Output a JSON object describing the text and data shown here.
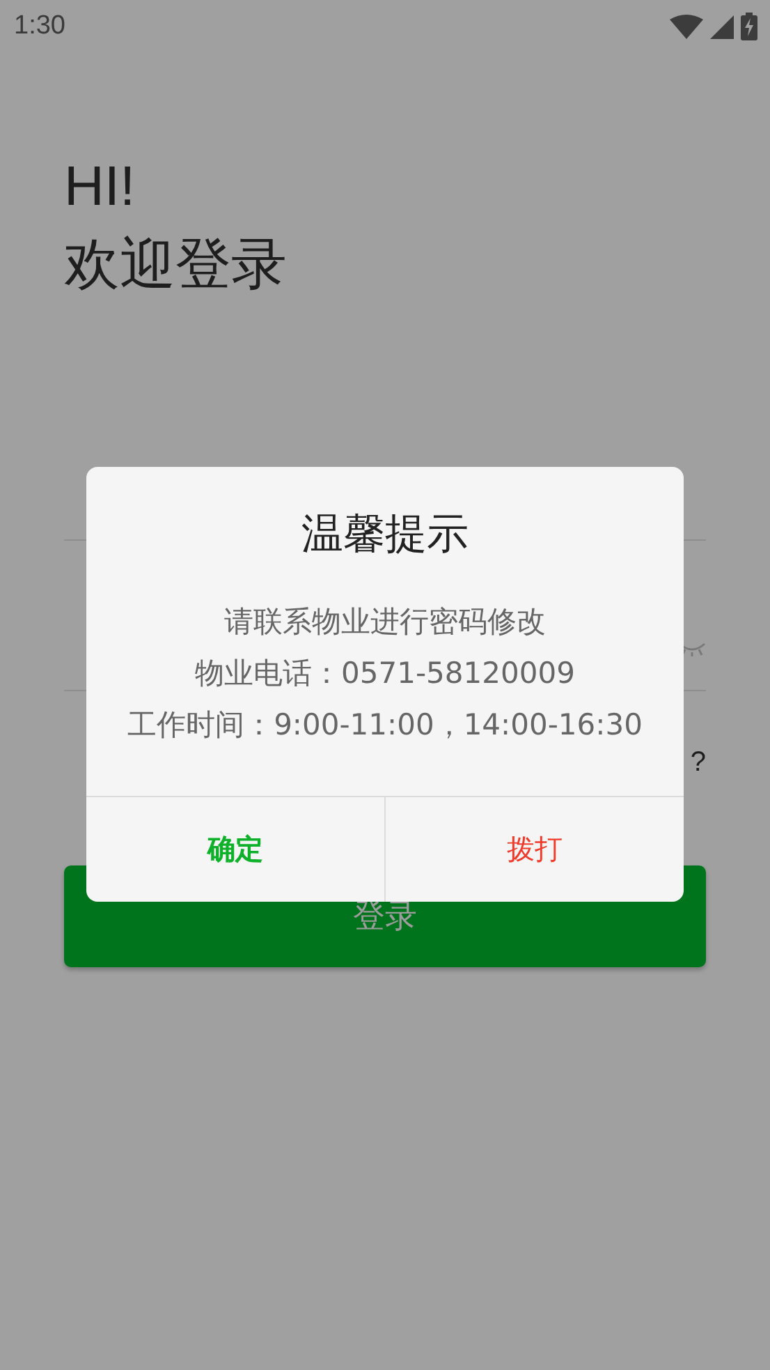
{
  "status_bar": {
    "time": "1:30"
  },
  "greeting": [
    "HI!",
    "欢迎登录"
  ],
  "fields": [
    {
      "kind": "text"
    },
    {
      "kind": "password"
    }
  ],
  "forgot_link": "?",
  "login_button": "登录",
  "dialog": {
    "title": "温馨提示",
    "message": [
      "请联系物业进行密码修改",
      "物业电话：0571-58120009",
      "工作时间：9:00-11:00，14:00-16:30"
    ],
    "buttons": [
      {
        "label": "确定",
        "color": "#10b12a"
      },
      {
        "label": "拨打",
        "color": "#f03a2a"
      }
    ]
  }
}
